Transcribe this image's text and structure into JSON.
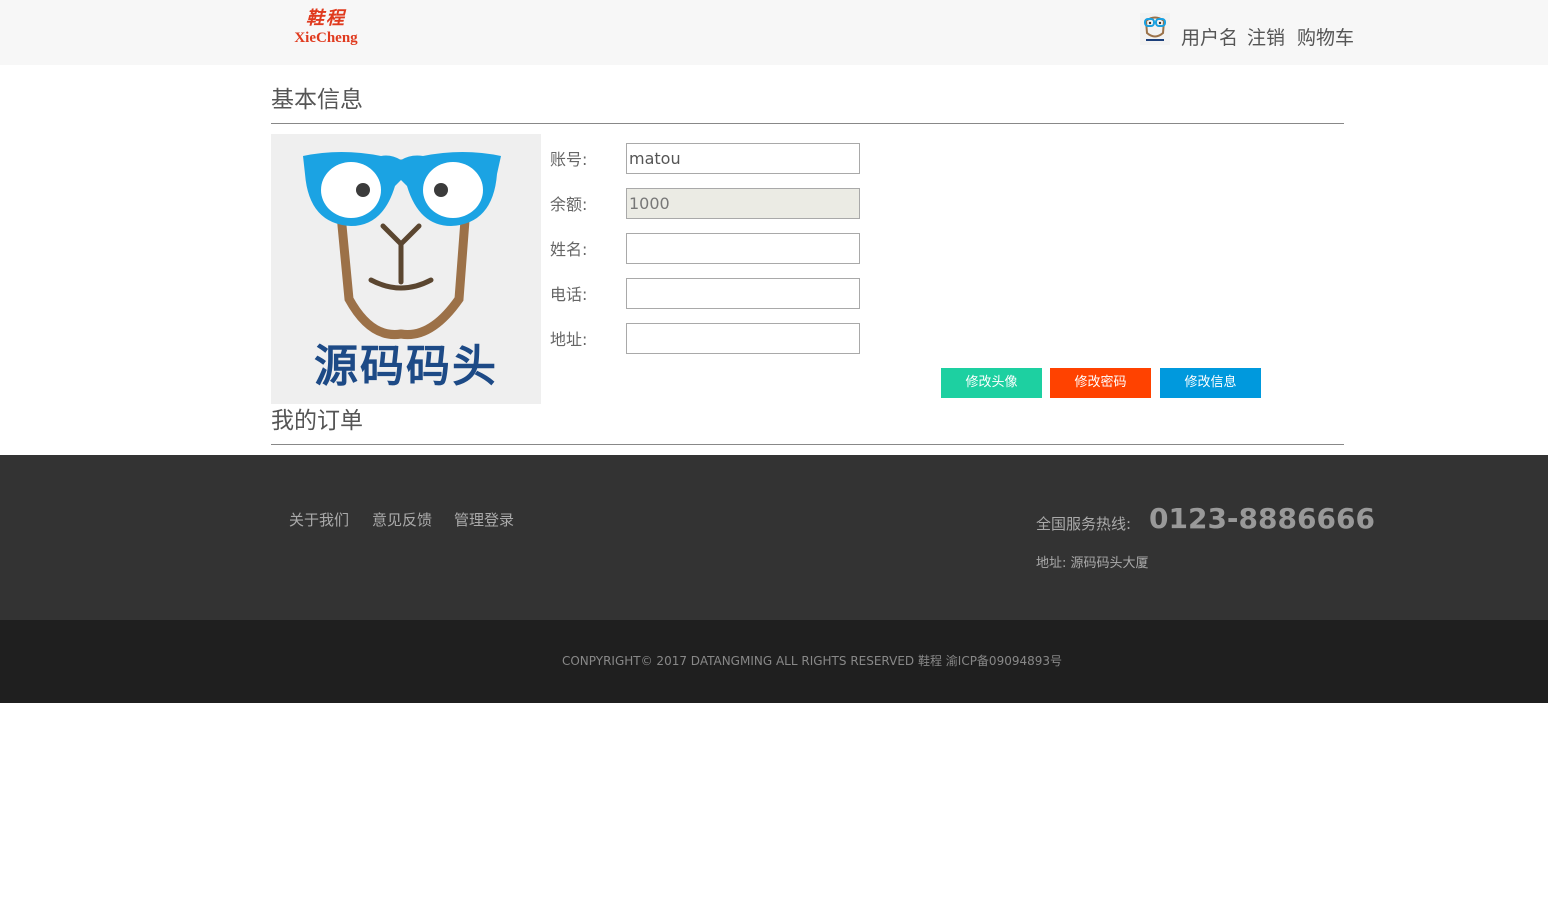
{
  "header": {
    "logo_cn": "鞋程",
    "logo_en": "XieCheng",
    "nav": {
      "username": "用户名",
      "logout": "注销",
      "cart": "购物车"
    }
  },
  "profile": {
    "section_title": "基本信息",
    "avatar_text": "源码码头",
    "fields": {
      "account_label": "账号:",
      "account_value": "matou",
      "balance_label": "余额:",
      "balance_value": "1000",
      "name_label": "姓名:",
      "name_value": "",
      "phone_label": "电话:",
      "phone_value": "",
      "address_label": "地址:",
      "address_value": ""
    },
    "buttons": {
      "avatar": "修改头像",
      "password": "修改密码",
      "info": "修改信息"
    }
  },
  "orders": {
    "section_title": "我的订单"
  },
  "footer": {
    "links": [
      "关于我们",
      "意见反馈",
      "管理登录"
    ],
    "hotline_label": "全国服务热线:",
    "hotline_number": "0123-8886666",
    "address": "地址: 源码码头大厦",
    "copyright": "CONPYRIGHT© 2017 DATANGMING ALL RIGHTS RESERVED 鞋程 渝ICP备09094893号"
  },
  "colors": {
    "btn_avatar": "#1dd0a1",
    "btn_password": "#ff4200",
    "btn_info": "#0099dd",
    "footer_top": "#333333",
    "footer_bottom": "#1f1f1f",
    "logo": "#e03a1e"
  }
}
